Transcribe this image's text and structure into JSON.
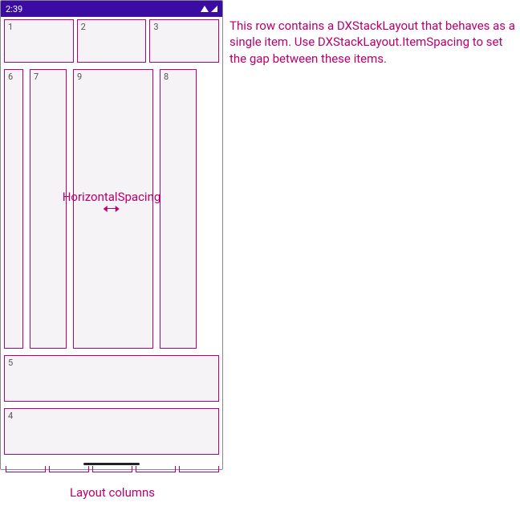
{
  "status": {
    "time": "2:39"
  },
  "cells": {
    "c1": "1",
    "c2": "2",
    "c3": "3",
    "c4": "4",
    "c5": "5",
    "c6": "6",
    "c7": "7",
    "c8": "8",
    "c9": "9"
  },
  "labels": {
    "horizontal_spacing": "HorizontalSpacing",
    "layout_columns": "Layout columns"
  },
  "annotation": {
    "text": "This row contains a DXStackLayout that behaves as a single item. Use DXStackLayout.ItemSpacing to set the gap between these items."
  },
  "colors": {
    "accent": "#b9006e",
    "status_bar": "#3a0ca3",
    "cell_bg": "#f6f3f6"
  },
  "layout": {
    "num_columns": 5
  }
}
